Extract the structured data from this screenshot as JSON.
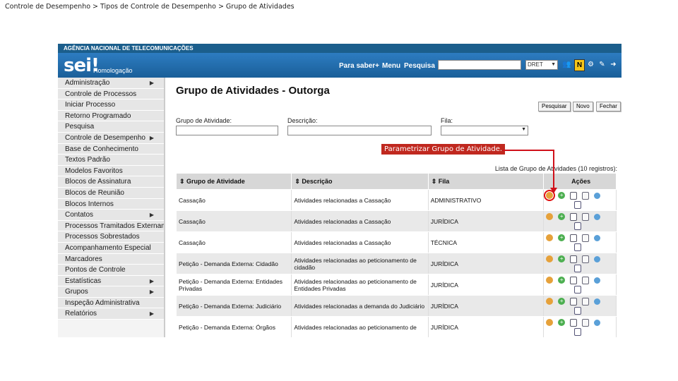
{
  "breadcrumb": "Controle de Desempenho > Tipos de Controle de Desempenho > Grupo de Atividades",
  "header": {
    "agency": "AGÊNCIA NACIONAL DE TELECOMUNICAÇÕES",
    "logo": "sei!",
    "env": "Homologação",
    "links": [
      "Para saber+",
      "Menu",
      "Pesquisa"
    ],
    "unit_select": "DRET"
  },
  "sidebar": {
    "items": [
      {
        "label": "Administração",
        "submenu": true
      },
      {
        "label": "Controle de Processos",
        "submenu": false
      },
      {
        "label": "Iniciar Processo",
        "submenu": false
      },
      {
        "label": "Retorno Programado",
        "submenu": false
      },
      {
        "label": "Pesquisa",
        "submenu": false
      },
      {
        "label": "Controle de Desempenho",
        "submenu": true
      },
      {
        "label": "Base de Conhecimento",
        "submenu": false
      },
      {
        "label": "Textos Padrão",
        "submenu": false
      },
      {
        "label": "Modelos Favoritos",
        "submenu": false
      },
      {
        "label": "Blocos de Assinatura",
        "submenu": false
      },
      {
        "label": "Blocos de Reunião",
        "submenu": false
      },
      {
        "label": "Blocos Internos",
        "submenu": false
      },
      {
        "label": "Contatos",
        "submenu": true
      },
      {
        "label": "Processos Tramitados Externamente",
        "submenu": false
      },
      {
        "label": "Processos Sobrestados",
        "submenu": false
      },
      {
        "label": "Acompanhamento Especial",
        "submenu": false
      },
      {
        "label": "Marcadores",
        "submenu": false
      },
      {
        "label": "Pontos de Controle",
        "submenu": false
      },
      {
        "label": "Estatísticas",
        "submenu": true
      },
      {
        "label": "Grupos",
        "submenu": true
      },
      {
        "label": "Inspeção Administrativa",
        "submenu": false
      },
      {
        "label": "Relatórios",
        "submenu": true
      }
    ]
  },
  "main": {
    "title": "Grupo de Atividades - Outorga",
    "buttons": {
      "search": "Pesquisar",
      "new": "Novo",
      "close": "Fechar"
    },
    "filters": {
      "group_label": "Grupo de Atividade:",
      "desc_label": "Descrição:",
      "queue_label": "Fila:",
      "group_value": "",
      "desc_value": "",
      "queue_value": ""
    },
    "table_caption": "Lista de Grupo de Atividades (10 registros):",
    "columns": [
      "Grupo de Atividade",
      "Descrição",
      "Fila",
      "Ações"
    ],
    "rows": [
      {
        "grupo": "Cassação",
        "descricao": "Atividades relacionadas a Cassação",
        "fila": "ADMINISTRATIVO"
      },
      {
        "grupo": "Cassação",
        "descricao": "Atividades relacionadas a Cassação",
        "fila": "JURÍDICA"
      },
      {
        "grupo": "Cassação",
        "descricao": "Atividades relacionadas a Cassação",
        "fila": "TÉCNICA"
      },
      {
        "grupo": "Petição - Demanda Externa: Cidadão",
        "descricao": "Atividades relacionadas ao peticionamento de cidadão",
        "fila": "JURÍDICA"
      },
      {
        "grupo": "Petição - Demanda Externa: Entidades Privadas",
        "descricao": "Atividades relacionadas ao peticionamento de Entidades Privadas",
        "fila": "JURÍDICA"
      },
      {
        "grupo": "Petição - Demanda Externa: Judiciário",
        "descricao": "Atividades relacionadas a demanda do Judiciário",
        "fila": "JURÍDICA"
      },
      {
        "grupo": "Petição - Demanda Externa: Órgãos",
        "descricao": "Atividades relacionadas ao peticionamento de",
        "fila": "JURÍDICA"
      }
    ]
  },
  "callout": "Parametrizar Grupo de Atividade.",
  "colors": {
    "header_blue": "#2d7cc1",
    "topbar": "#1b5e8c",
    "callout_red": "#c0281f"
  }
}
